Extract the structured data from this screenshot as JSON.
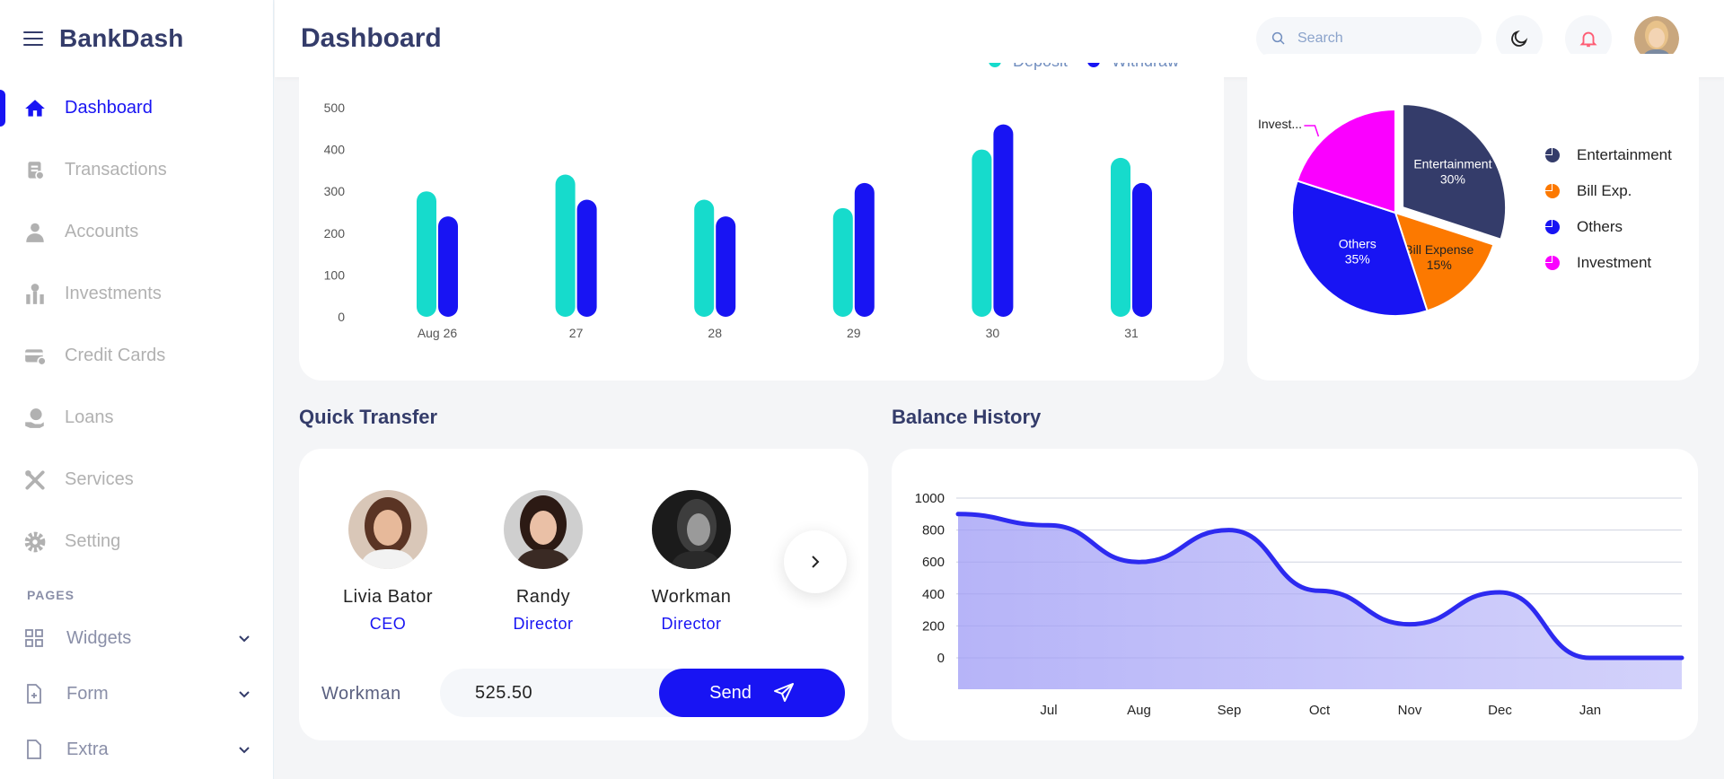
{
  "app": {
    "name": "BankDash"
  },
  "sidebar": {
    "items": [
      {
        "label": "Dashboard",
        "icon": "home-icon",
        "active": true
      },
      {
        "label": "Transactions",
        "icon": "transactions-icon"
      },
      {
        "label": "Accounts",
        "icon": "user-icon"
      },
      {
        "label": "Investments",
        "icon": "investment-icon"
      },
      {
        "label": "Credit Cards",
        "icon": "credit-card-icon"
      },
      {
        "label": "Loans",
        "icon": "loan-icon"
      },
      {
        "label": "Services",
        "icon": "services-icon"
      },
      {
        "label": "Setting",
        "icon": "gear-icon"
      }
    ],
    "pages_label": "PAGES",
    "pages": [
      {
        "label": "Widgets",
        "icon": "grid-icon"
      },
      {
        "label": "Form",
        "icon": "file-plus-icon"
      },
      {
        "label": "Extra",
        "icon": "file-icon"
      }
    ]
  },
  "header": {
    "title": "Dashboard",
    "search_placeholder": "Search"
  },
  "colors": {
    "primary": "#1814f3",
    "deposit": "#16dbcc",
    "withdraw": "#1814f3",
    "entertainment": "#343c6a",
    "bill": "#fc7900",
    "others": "#1814f3",
    "investment": "#fa00ff"
  },
  "chart_data": [
    {
      "type": "bar",
      "categories": [
        "Aug 26",
        "27",
        "28",
        "29",
        "30",
        "31"
      ],
      "series": [
        {
          "name": "Deposit",
          "values": [
            300,
            340,
            280,
            260,
            400,
            380
          ]
        },
        {
          "name": "Withdraw",
          "values": [
            240,
            280,
            240,
            320,
            460,
            320
          ]
        }
      ],
      "yticks": [
        0,
        100,
        200,
        300,
        400,
        500
      ],
      "ylim": [
        0,
        500
      ],
      "legend": "top-right"
    },
    {
      "type": "pie",
      "labels": [
        "Entertainment",
        "Bill Expense",
        "Others",
        "Investment"
      ],
      "slice_labels": [
        "Entertainment\n30%",
        "Bill Expense\n15%",
        "Others\n35%",
        "Invest..."
      ],
      "values": [
        30,
        15,
        35,
        20
      ],
      "legend_labels": [
        "Entertainment",
        "Bill Exp.",
        "Others",
        "Investment"
      ],
      "legend": "right"
    },
    {
      "type": "area",
      "categories": [
        "Jul",
        "Aug",
        "Sep",
        "Oct",
        "Nov",
        "Dec",
        "Jan"
      ],
      "x": [
        0,
        1,
        2,
        3,
        4,
        5,
        6,
        7
      ],
      "values": [
        900,
        830,
        600,
        800,
        420,
        210,
        410,
        0
      ],
      "end_value": 0,
      "yticks": [
        0,
        200,
        400,
        600,
        800,
        1000
      ],
      "ylim": [
        0,
        1000
      ]
    }
  ],
  "quick_transfer": {
    "title": "Quick Transfer",
    "contacts": [
      {
        "name": "Livia Bator",
        "role": "CEO"
      },
      {
        "name": "Randy",
        "role": "Director"
      },
      {
        "name": "Workman",
        "role": "Director"
      }
    ],
    "recipient": "Workman",
    "amount": "525.50",
    "send_label": "Send"
  },
  "balance_history": {
    "title": "Balance History"
  }
}
